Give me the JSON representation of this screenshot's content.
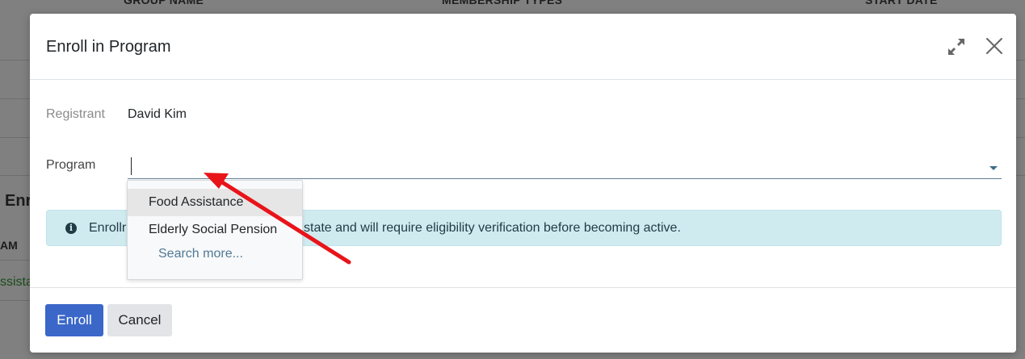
{
  "background": {
    "headers": [
      "GROUP NAME",
      "MEMBERSHIP TYPES",
      "START DATE"
    ],
    "section_title_partial": "Enr",
    "column_partial": "AM",
    "cell_partial": "ssistar"
  },
  "modal": {
    "title": "Enroll in Program",
    "registrant_label": "Registrant",
    "registrant_value": "David Kim",
    "program_label": "Program",
    "program_value": "",
    "alert_text_visible_start": "Enrollr",
    "alert_text_visible_end": "state and will require eligibility verification before becoming active.",
    "dropdown": {
      "options": [
        "Food Assistance",
        "Elderly Social Pension"
      ],
      "search_more": "Search more..."
    },
    "footer": {
      "enroll_label": "Enroll",
      "cancel_label": "Cancel"
    }
  },
  "colors": {
    "primary": "#3a67c8",
    "alert_bg": "#d0ebf0",
    "annotation": "#e8141a"
  }
}
